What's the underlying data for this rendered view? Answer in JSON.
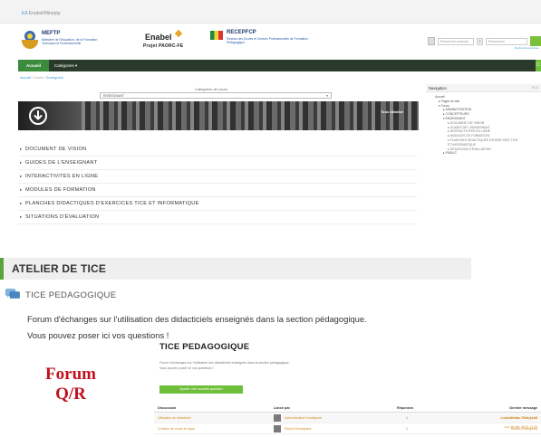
{
  "topbar": {
    "site_name_prefix": "EA",
    "site_name": "Enabel/Mineptp"
  },
  "header": {
    "mineptp": {
      "name": "MEFTP",
      "subtitle": "Ministère de l'Education, de la Formation Technique et Professionnelle"
    },
    "enabel": {
      "name": "Enabel",
      "project": "Projet PAORC-FE"
    },
    "recep": {
      "name": "RECEPFCP",
      "subtitle": "Réseau des Ecoles et Centres Professionnels de Formation Pédagogique"
    },
    "search": {
      "advanced_placeholder": "Recherche avancée",
      "site_placeholder": "Rechercher",
      "advanced_link": "Recherche avancée"
    }
  },
  "nav": {
    "home": "Accueil",
    "categories": "Catégories ▾",
    "end_icon": "C"
  },
  "breadcrumb": {
    "home": "Accueil",
    "sep": " / Cours / ",
    "current": "Enseignant"
  },
  "category_picker": {
    "label": "Catégories de cours",
    "selected": "ENSEIGNANT",
    "caret": "▾"
  },
  "banner": {
    "tag": "Tous idéalisé"
  },
  "categories": [
    "Document de vision",
    "Guides de l'enseignant",
    "Interactivités en ligne",
    "Modules de formation",
    "Planches didactiques d'exercices TICE et informatique",
    "Situations d'évaluation"
  ],
  "sidebar_nav": {
    "title": "Navigation",
    "controls": "⊟ ⊡",
    "tree": [
      {
        "level": 1,
        "label": "Accueil"
      },
      {
        "level": 2,
        "label": "▸ Pages du site"
      },
      {
        "level": 2,
        "label": "▾ Cours"
      },
      {
        "level": 3,
        "label": "▸ ADMINISTRATION"
      },
      {
        "level": 3,
        "label": "▸ CONCEPTEURS"
      },
      {
        "level": 3,
        "label": "▾ ENSEIGNANT"
      },
      {
        "level": 4,
        "label": "▸ DOCUMENT DE VISION"
      },
      {
        "level": 4,
        "label": "▸ GUIDES DE L'ENSEIGNANT"
      },
      {
        "level": 4,
        "label": "▸ INTERACTIVITÉS EN LIGNE"
      },
      {
        "level": 4,
        "label": "▸ MODULES DE FORMATION"
      },
      {
        "level": 4,
        "label": "▸ PLANCHES DIDACTIQUES D'EXERCICES TICE"
      },
      {
        "level": 4,
        "label": "  ET INFORMATIQUE"
      },
      {
        "level": 4,
        "label": "▸ SITUATIONS D'ÉVALUATION"
      },
      {
        "level": 3,
        "label": "▸ PUBLIC"
      }
    ]
  },
  "atelier": {
    "title": "ATELIER DE TICE"
  },
  "forum": {
    "name": "TICE PEDAGOGIQUE",
    "description_line1": "Forum d'échanges sur l'utilisation des didacticiels enseignés dans la section pédagogique.",
    "description_line2": "Vous pouvez poser ici vos questions !"
  },
  "forum_qr": {
    "line1": "Forum",
    "line2": "Q/R"
  },
  "mini_forum": {
    "title": "TICE PEDAGOGIQUE",
    "desc_line1": "Forum d'échanges sur l'utilisation des didacticiels enseignés dans la section pédagogique.",
    "desc_line2": "Vous pouvez poser ici vos questions !",
    "add_button": "Ajouter une nouvelle question",
    "columns": {
      "discussion": "Discussion",
      "started_by": "Lancé par",
      "replies": "Réponses",
      "last_message": "Dernier message"
    },
    "rows": [
      {
        "discussion": "Utilisation de didacticiel",
        "author": "Administrateur Enseignant",
        "replies": "1",
        "last_author": "Administrateur Enseignant",
        "last_date": "Lun 16 déc. 2019, 11:48"
      },
      {
        "discussion": "Création de cours en ligne",
        "author": "Rachid Enseignant",
        "replies": "1",
        "last_author": "Rachid Enseignant",
        "last_date": "Lun 16 déc. 2019, 11:20"
      }
    ]
  }
}
